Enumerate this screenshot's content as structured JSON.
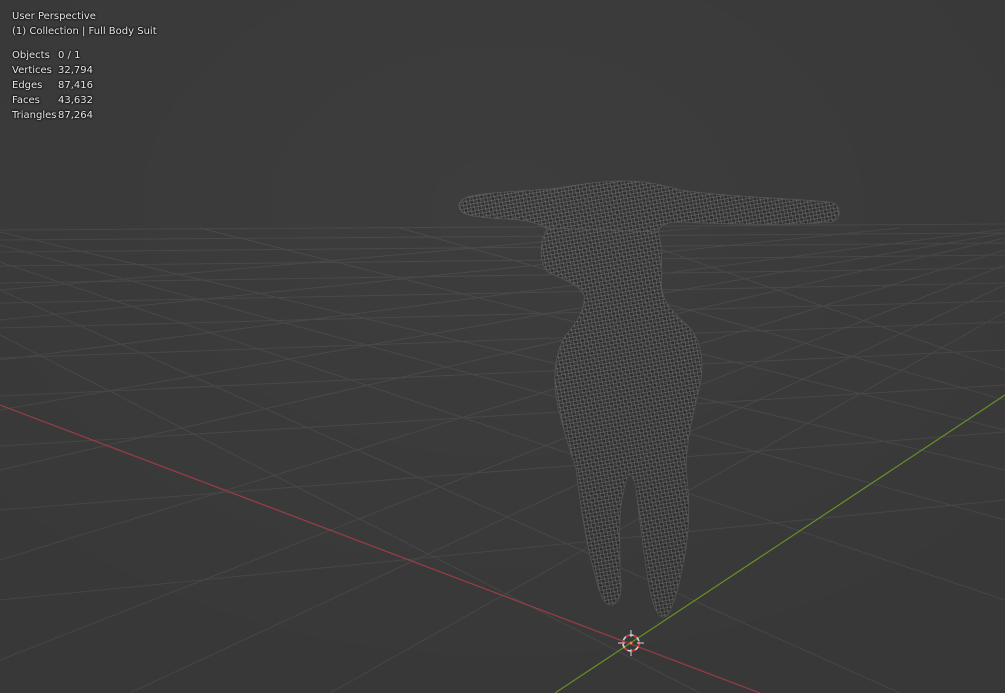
{
  "viewport": {
    "view_name": "User Perspective",
    "collection_info": "(1) Collection | Full Body Suit",
    "stats": [
      {
        "label": "Objects",
        "value": "0 / 1"
      },
      {
        "label": "Vertices",
        "value": "32,794"
      },
      {
        "label": "Edges",
        "value": "87,416"
      },
      {
        "label": "Faces",
        "value": "43,632"
      },
      {
        "label": "Triangles",
        "value": "87,264"
      }
    ],
    "colors": {
      "background": "#3d3d3d",
      "grid": "#4a4a4a",
      "x_axis": "#a8404a",
      "y_axis": "#6c9a2a",
      "mesh": "#9a9a9a",
      "cursor_ring": "#e6e6e6",
      "cursor_dash": "#d23a3a"
    },
    "icons": {
      "cursor": "3d-cursor-icon",
      "mesh": "wireframe-mesh-body-suit"
    }
  }
}
